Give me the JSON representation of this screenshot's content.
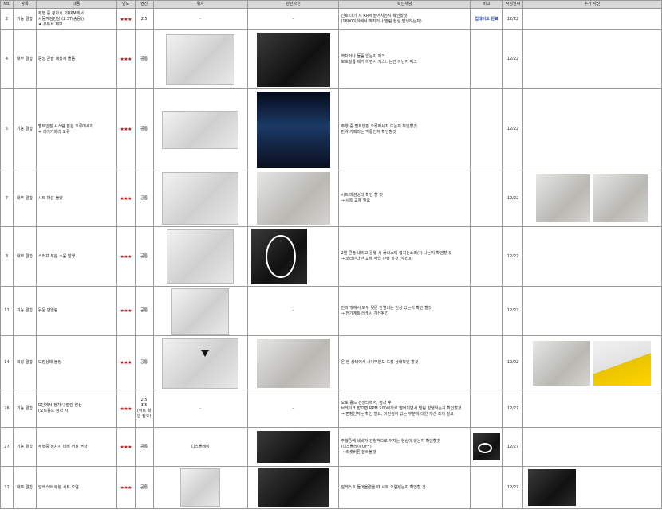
{
  "headers": [
    "No.",
    "항목",
    "내용",
    "빈도",
    "엔진",
    "위치",
    "관련사진",
    "확인사항",
    "비고",
    "작성날짜",
    "추가 사진"
  ],
  "rows": [
    {
      "no": "2",
      "cat": "기능 결함",
      "content": "주행 중 정차시 저RPM에서\n시동꺼짐현상 (2.5T(숭용))\n★ 유튜브 제보",
      "freq": "★★★",
      "engine": "2.5",
      "location": "-",
      "photo_text": "-",
      "check": "신호 대기 시 RPM 떨어지는지 확인할것\n(1800이하에서 꺼지거나 떨림 현상 발생하는지)",
      "note": "업데이트 완료",
      "date": "12/22"
    },
    {
      "no": "4",
      "cat": "내부 결함",
      "content": "중앙 콘솔 내장재 들뜸",
      "freq": "★★★",
      "engine": "공통",
      "location": "",
      "photo_text": "",
      "check": "핵치거나 들뜸 없는지 체크\n보호필름 제거 하면서 기스나는건 아닌지 체크",
      "note": "",
      "date": "12/22"
    },
    {
      "no": "5",
      "cat": "기능 결함",
      "content": "벨트인점 시스템 점검 오류메세지\n+ 리어카메라 오류",
      "freq": "★★★",
      "engine": "공통",
      "location": "",
      "photo_text": "",
      "check": "주행 중 벨트인점 오류메세지 뜨는지 확인할것\n만약 카메라는 먹통인지 확인할것",
      "note": "",
      "date": "12/22"
    },
    {
      "no": "7",
      "cat": "내부 결함",
      "content": "시트 마감 불량",
      "freq": "★★★",
      "engine": "공통",
      "location": "",
      "photo_text": "",
      "check": "시트 마감상태 확인 할 것\n→ 시트 교체 필요",
      "note": "",
      "date": "12/22"
    },
    {
      "no": "8",
      "cat": "내부 결함",
      "content": "스커프 부분 소음 발생",
      "freq": "★★★",
      "engine": "공통",
      "location": "",
      "photo_text": "",
      "check": "2열 콘솔 내리고 운행 시 플라스틱 접치는소리(?) 나는지 확인할 것\n→ 소리난다면 교체 작업 진행 할것 (수리X)",
      "note": "",
      "date": "12/22"
    },
    {
      "no": "11",
      "cat": "기능 결함",
      "content": "뒷문 안열림",
      "freq": "★★★",
      "engine": "공통",
      "location": "",
      "photo_text": "-",
      "check": "안과 밖에서 모두 뒷문 안열리는 현상 있는지 확인 할것\n→ 전기계통 레셋시 개선됨?",
      "note": "",
      "date": "12/22"
    },
    {
      "no": "14",
      "cat": "외장 결함",
      "content": "도장상태 불량",
      "freq": "★★★",
      "engine": "공통",
      "location": "",
      "photo_text": "",
      "check": "온 앤 상태에서 사이부분도 도장 상태확인 할것",
      "note": "",
      "date": "12/22"
    },
    {
      "no": "26",
      "cat": "기능 결함",
      "content": "D단에서 정차시 떨림 현상\n(오토홀드 정차 시)",
      "freq": "★★★",
      "engine": "2.5\n3.5\n(하트 확인 필요)",
      "location": "-",
      "photo_text": "-",
      "check": "오토 홀드 진성태에서, 정차 후\n브레이크 밟으면 RPM 500이하로 떨어지면서 떨림 발생하는지 확인할것\n→ 편항인지는 확인 필요, 이런정이 있는 부분에 대한 개선 조치 필요",
      "note": "",
      "date": "12/27"
    },
    {
      "no": "27",
      "cat": "기능 결함",
      "content": "주행중 정차시 네비 꺼짐 현상",
      "freq": "★★★",
      "engine": "공통",
      "location": "디스플레이",
      "photo_text": "",
      "check": "주행중에 네비가 간헐적으로 꺼지는 현상이 있는지 확인할것\n(디스플레이 OFF)\n→ 리셋버튼 눌러볼것",
      "note": "",
      "date": "12/27"
    },
    {
      "no": "31",
      "cat": "내부 결함",
      "content": "암레스트 부분 시트 오염",
      "freq": "★★★",
      "engine": "공통",
      "location": "",
      "photo_text": "",
      "check": "암레스트 들어올렸을 때 시트 오염됐는지 확인할 것",
      "note": "",
      "date": "12/27"
    }
  ],
  "icons": {
    "location_photo": "car-interior-photo",
    "related_photo": "defect-closeup-photo",
    "extra_photo": "additional-photo"
  },
  "colors": {
    "stars": "#d00000",
    "note_highlight": "#1f3fb3",
    "header_bg": "#d8d8d8",
    "grid": "#9a9a9a"
  }
}
